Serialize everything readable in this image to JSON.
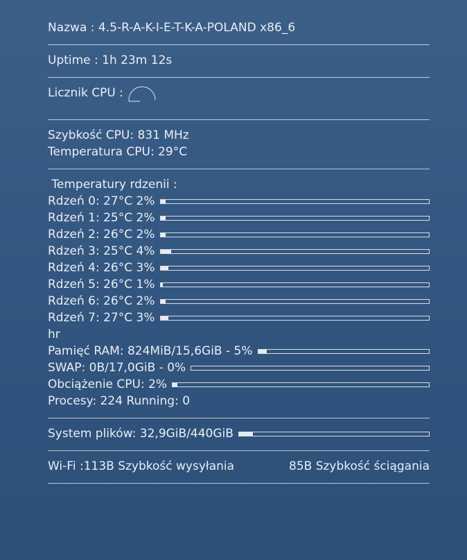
{
  "system": {
    "name_label": "Nazwa : 4.5-R-A-K-I-E-T-K-A-POLAND x86_6",
    "uptime_label": "Uptime : 1h 23m 12s",
    "cpu_counter_label": "Licznik CPU :",
    "cpu_speed_label": "Szybkość CPU: 831 MHz",
    "cpu_temp_label": "Temperatura CPU: 29°C"
  },
  "cores": {
    "header": " Temperatury rdzenii :",
    "items": [
      {
        "label": "Rdzeń 0: 27°C 2%",
        "percent": 2
      },
      {
        "label": "Rdzeń 1: 25°C 2%",
        "percent": 2
      },
      {
        "label": "Rdzeń 2: 26°C 2%",
        "percent": 2
      },
      {
        "label": "Rdzeń 3: 25°C 4%",
        "percent": 4
      },
      {
        "label": "Rdzeń 4: 26°C 3%",
        "percent": 3
      },
      {
        "label": "Rdzeń 5: 26°C 1%",
        "percent": 1
      },
      {
        "label": "Rdzeń 6: 26°C 2%",
        "percent": 2
      },
      {
        "label": "Rdzeń 7: 27°C 3%",
        "percent": 3
      }
    ]
  },
  "misc": {
    "hr_text": "hr"
  },
  "memory": {
    "ram_label": "Pamięć RAM: 824MiB/15,6GiB - 5%",
    "ram_percent": 5,
    "swap_label": "SWAP: 0B/17,0GiB - 0%",
    "swap_percent": 0,
    "load_label": "Obciążenie CPU: 2%",
    "load_percent": 2,
    "processes_label": "Procesy: 224 Running: 0"
  },
  "filesystem": {
    "label": "System plików: 32,9GiB/440GiB",
    "percent": 7.5
  },
  "network": {
    "upload_label": "Wi-Fi :113B Szybkość wysyłania",
    "download_label": "85B Szybkość ściągania"
  },
  "colors": {
    "background_top": "#3c5f88",
    "background_bottom": "#2d5078",
    "text": "#e9eef5"
  }
}
